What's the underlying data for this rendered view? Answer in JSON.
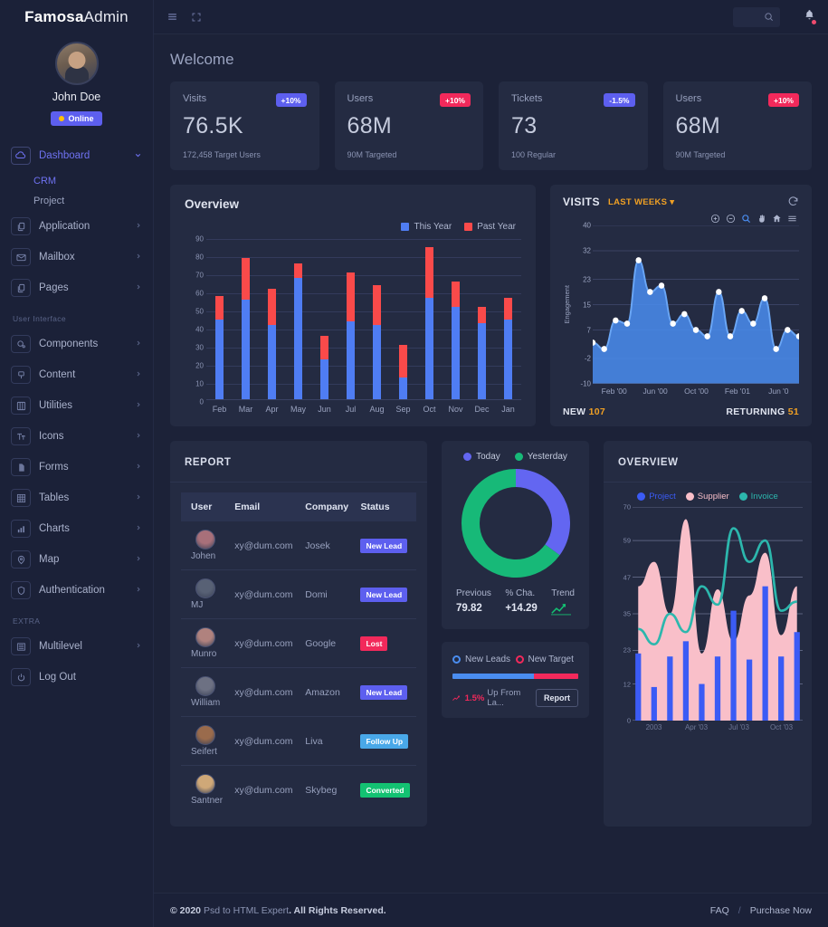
{
  "brand": {
    "bold": "Famosa",
    "light": "Admin"
  },
  "profile": {
    "name": "John Doe",
    "status": "Online"
  },
  "sidebar": {
    "items": [
      {
        "label": "Dashboard",
        "icon": "cloud-icon",
        "arrow": "chevron-down-icon",
        "active": true
      },
      {
        "label": "Application",
        "icon": "copy-icon",
        "arrow": "chevron-right-icon"
      },
      {
        "label": "Mailbox",
        "icon": "mail-icon",
        "arrow": "chevron-right-icon"
      },
      {
        "label": "Pages",
        "icon": "copy-icon",
        "arrow": "chevron-right-icon"
      }
    ],
    "sub_items": [
      {
        "label": "CRM",
        "active": true
      },
      {
        "label": "Project",
        "active": false
      }
    ],
    "section_ui": "User Interface",
    "ui_items": [
      {
        "label": "Components",
        "icon": "palette-icon",
        "arrow": "chevron-right-icon"
      },
      {
        "label": "Content",
        "icon": "pin-icon",
        "arrow": "chevron-right-icon"
      },
      {
        "label": "Utilities",
        "icon": "grid-icon",
        "arrow": "chevron-right-icon"
      },
      {
        "label": "Icons",
        "icon": "text-icon",
        "arrow": "chevron-right-icon"
      },
      {
        "label": "Forms",
        "icon": "file-icon",
        "arrow": "chevron-right-icon"
      },
      {
        "label": "Tables",
        "icon": "table-icon",
        "arrow": "chevron-right-icon"
      },
      {
        "label": "Charts",
        "icon": "bar-chart-icon",
        "arrow": "chevron-right-icon"
      },
      {
        "label": "Map",
        "icon": "map-icon",
        "arrow": "chevron-right-icon"
      },
      {
        "label": "Authentication",
        "icon": "shield-icon",
        "arrow": "chevron-right-icon"
      }
    ],
    "section_extra": "EXTRA",
    "extra_items": [
      {
        "label": "Multilevel",
        "icon": "layers-icon",
        "arrow": "chevron-right-icon"
      },
      {
        "label": "Log Out",
        "icon": "power-icon",
        "arrow": ""
      }
    ]
  },
  "topbar": {
    "menu_icon": "hamburger-icon",
    "fullscreen_icon": "expand-icon",
    "search_icon": "search-icon",
    "search_placeholder": "",
    "bell_icon": "bell-icon"
  },
  "page": {
    "title": "Welcome"
  },
  "stats": [
    {
      "label": "Visits",
      "badge": "+10%",
      "badge_color": "#5d5fef",
      "value": "76.5K",
      "sub": "172,458 Target Users"
    },
    {
      "label": "Users",
      "badge": "+10%",
      "badge_color": "#f2295b",
      "value": "68M",
      "sub": "90M Targeted"
    },
    {
      "label": "Tickets",
      "badge": "-1.5%",
      "badge_color": "#5d5fef",
      "value": "73",
      "sub": "100 Regular"
    },
    {
      "label": "Users",
      "badge": "+10%",
      "badge_color": "#f2295b",
      "value": "68M",
      "sub": "90M Targeted"
    }
  ],
  "overview_card": {
    "title": "Overview"
  },
  "visits_card": {
    "title": "VISITS",
    "selector": "LAST WEEKS",
    "reset_icon": "reset-icon",
    "tools": [
      {
        "name": "zoom-in-icon",
        "active": false
      },
      {
        "name": "zoom-out-icon",
        "active": false
      },
      {
        "name": "selection-zoom-icon",
        "active": true
      },
      {
        "name": "pan-icon",
        "active": false
      },
      {
        "name": "home-reset-icon",
        "active": false
      },
      {
        "name": "menu-icon",
        "active": false
      }
    ],
    "footer_new_label": "NEW",
    "footer_new_value": "107",
    "footer_returning_label": "RETURNING",
    "footer_returning_value": "51"
  },
  "report": {
    "title": "REPORT",
    "columns": [
      "User",
      "Email",
      "Company",
      "Status"
    ],
    "rows": [
      {
        "user": "Johen",
        "email": "xy@dum.com",
        "company": "Josek",
        "status": "New Lead",
        "status_color": "#5d5fef",
        "avatar_hue": "#a8707a"
      },
      {
        "user": "MJ",
        "email": "xy@dum.com",
        "company": "Domi",
        "status": "New Lead",
        "status_color": "#5d5fef",
        "avatar_hue": "#586175"
      },
      {
        "user": "Munro",
        "email": "xy@dum.com",
        "company": "Google",
        "status": "Lost",
        "status_color": "#f2295b",
        "avatar_hue": "#b0827e"
      },
      {
        "user": "William",
        "email": "xy@dum.com",
        "company": "Amazon",
        "status": "New Lead",
        "status_color": "#5d5fef",
        "avatar_hue": "#6d7183"
      },
      {
        "user": "Seifert",
        "email": "xy@dum.com",
        "company": "Liva",
        "status": "Follow Up",
        "status_color": "#49a8e8",
        "avatar_hue": "#9a6b4c"
      },
      {
        "user": "Santner",
        "email": "xy@dum.com",
        "company": "Skybeg",
        "status": "Converted",
        "status_color": "#13c272",
        "avatar_hue": "#cfa878"
      }
    ]
  },
  "donut": {
    "previous_label": "Previous",
    "previous_value": "79.82",
    "change_label": "% Cha.",
    "change_value": "+14.29",
    "trend_label": "Trend",
    "trend_icon": "trend-up-icon"
  },
  "leads": {
    "left_label": "New Leads",
    "right_label": "New Target",
    "pct_icon": "trend-up-icon",
    "pct_value": "1.5%",
    "pct_text": "Up From La...",
    "button": "Report"
  },
  "overview2_card": {
    "title": "OVERVIEW"
  },
  "footer": {
    "copy": "© 2020",
    "brand": "Psd to HTML Expert",
    "rights": ". All Rights Reserved.",
    "faq": "FAQ",
    "sep": "/",
    "purchase": "Purchase Now"
  },
  "chart_data": [
    {
      "type": "bar",
      "id": "overview-stacked-bars",
      "title": "Overview",
      "stacked": true,
      "categories": [
        "Feb",
        "Mar",
        "Apr",
        "May",
        "Jun",
        "Jul",
        "Aug",
        "Sep",
        "Oct",
        "Nov",
        "Dec",
        "Jan"
      ],
      "series": [
        {
          "name": "This Year",
          "color": "#4f7df3",
          "values": [
            44,
            55,
            41,
            67,
            22,
            43,
            41,
            12,
            56,
            51,
            42,
            44
          ]
        },
        {
          "name": "Past Year",
          "color": "#fa4a4a",
          "values": [
            13,
            23,
            20,
            8,
            13,
            27,
            22,
            18,
            28,
            14,
            9,
            12
          ]
        }
      ],
      "totals": [
        57,
        78,
        61,
        75,
        35,
        70,
        63,
        30,
        84,
        65,
        51,
        56
      ],
      "ylabel": "",
      "xlabel": "",
      "ylim": [
        0,
        90
      ],
      "yticks": [
        0,
        10,
        20,
        30,
        40,
        50,
        60,
        70,
        80,
        90
      ],
      "grid": true,
      "legend_position": "top-right"
    },
    {
      "type": "area",
      "id": "visits-engagement",
      "title": "VISITS",
      "ylabel": "Engagement",
      "xlabel": "",
      "ylim": [
        -10,
        40
      ],
      "yticks": [
        -10,
        -2,
        7,
        15,
        23,
        32,
        40
      ],
      "xticks": [
        "Feb '00",
        "Jun '00",
        "Oct '00",
        "Feb '01",
        "Jun '0"
      ],
      "color": "#4a8df0",
      "grid": true,
      "values": [
        3,
        1,
        10,
        9,
        29,
        19,
        21,
        9,
        12,
        7,
        5,
        19,
        5,
        13,
        9,
        17,
        1,
        7,
        5
      ]
    },
    {
      "type": "pie",
      "id": "today-yesterday-donut",
      "donut": true,
      "labels": [
        "Today",
        "Yesterday"
      ],
      "values": [
        35,
        65
      ],
      "colors": [
        "#6366f1",
        "#17b978"
      ]
    },
    {
      "type": "bar",
      "id": "leads-progress",
      "labels": [
        "New Leads",
        "New Target"
      ],
      "values": [
        65,
        35
      ],
      "colors": [
        "#4a8df0",
        "#f2295b"
      ]
    },
    {
      "type": "area",
      "id": "overview-multi",
      "title": "OVERVIEW",
      "ylim": [
        0,
        70
      ],
      "yticks": [
        0,
        12,
        23,
        35,
        47,
        59,
        70
      ],
      "xticks": [
        "2003",
        "Apr '03",
        "Jul '03",
        "Oct '03"
      ],
      "grid": true,
      "series": [
        {
          "name": "Project",
          "type": "bar",
          "color": "#3b5bf5",
          "values": [
            22,
            11,
            21,
            26,
            12,
            21,
            36,
            20,
            44,
            21,
            29
          ]
        },
        {
          "name": "Supplier",
          "type": "area",
          "color": "#f9bfc9",
          "values": [
            44,
            52,
            35,
            66,
            22,
            43,
            26,
            41,
            55,
            28,
            44
          ]
        },
        {
          "name": "Invoice",
          "type": "line",
          "color": "#2cb7ad",
          "values": [
            30,
            25,
            35,
            29,
            44,
            38,
            63,
            52,
            59,
            36,
            39
          ]
        }
      ]
    }
  ]
}
